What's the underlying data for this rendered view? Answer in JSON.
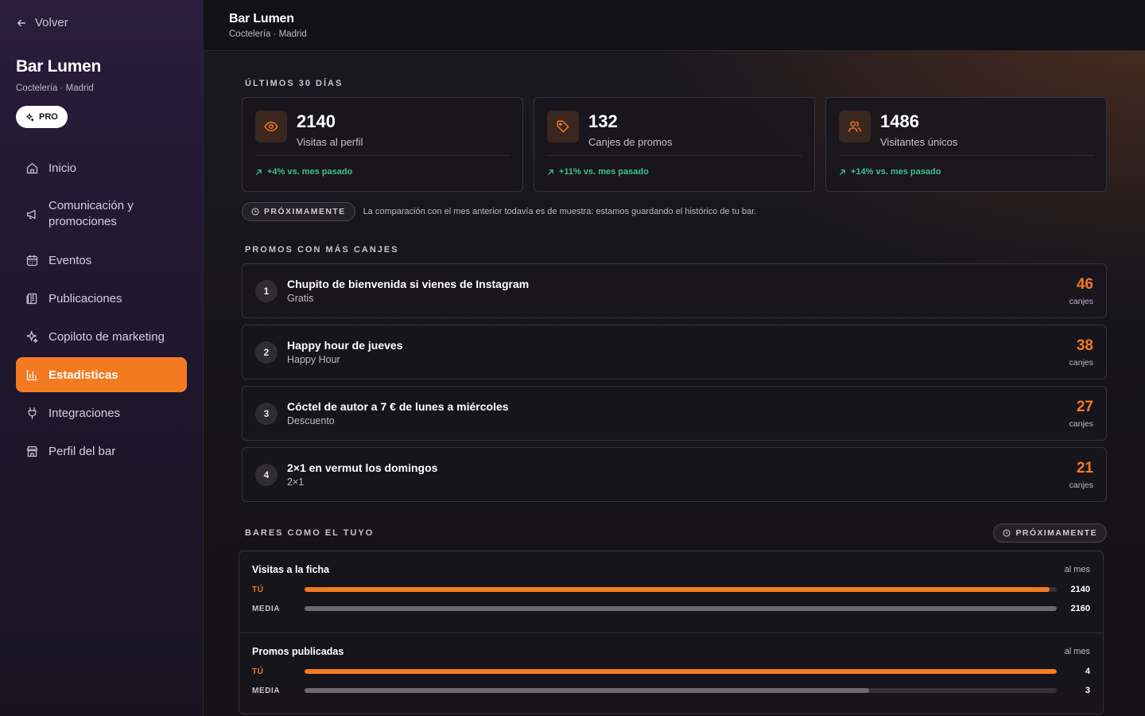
{
  "sidebar": {
    "back_label": "Volver",
    "bar_name": "Bar Lumen",
    "bar_subtitle": "Coctelería · Madrid",
    "plan_badge": "PRO",
    "nav": [
      {
        "label": "Inicio",
        "icon": "home-icon"
      },
      {
        "label": "Comunicación y promociones",
        "icon": "megaphone-icon"
      },
      {
        "label": "Eventos",
        "icon": "calendar-icon"
      },
      {
        "label": "Publicaciones",
        "icon": "newspaper-icon"
      },
      {
        "label": "Copiloto de marketing",
        "icon": "sparkles-icon"
      },
      {
        "label": "Estadísticas",
        "icon": "bar-chart-icon",
        "active": true
      },
      {
        "label": "Integraciones",
        "icon": "plug-icon"
      },
      {
        "label": "Perfil del bar",
        "icon": "store-icon"
      }
    ]
  },
  "header": {
    "title": "Bar Lumen",
    "subtitle": "Coctelería · Madrid"
  },
  "stats": {
    "section_label": "Últimos 30 días",
    "cards": [
      {
        "value": "2140",
        "label": "Visitas al perfil",
        "trend": "+4% vs. mes pasado",
        "icon": "eye-icon"
      },
      {
        "value": "132",
        "label": "Canjes de promos",
        "trend": "+11% vs. mes pasado",
        "icon": "tag-icon"
      },
      {
        "value": "1486",
        "label": "Visitantes únicos",
        "trend": "+14% vs. mes pasado",
        "icon": "users-icon"
      }
    ],
    "soon_badge": "PRÓXIMAMENTE",
    "soon_note": "La comparación con el mes anterior todavía es de muestra: estamos guardando el histórico de tu bar."
  },
  "promos": {
    "section_label": "Promos con más canjes",
    "unit": "canjes",
    "items": [
      {
        "rank": "1",
        "title": "Chupito de bienvenida si vienes de Instagram",
        "type": "Gratis",
        "count": "46"
      },
      {
        "rank": "2",
        "title": "Happy hour de jueves",
        "type": "Happy Hour",
        "count": "38"
      },
      {
        "rank": "3",
        "title": "Cóctel de autor a 7 € de lunes a miércoles",
        "type": "Descuento",
        "count": "27"
      },
      {
        "rank": "4",
        "title": "2×1 en vermut los domingos",
        "type": "2×1",
        "count": "21"
      }
    ]
  },
  "benchmark": {
    "section_label": "Bares como el tuyo",
    "soon_badge": "PRÓXIMAMENTE",
    "you_label": "TÚ",
    "avg_label": "MEDIA",
    "metrics": [
      {
        "title": "Visitas a la ficha",
        "unit": "al mes",
        "you": 2140,
        "avg": 2160,
        "you_label_value": "2140",
        "avg_label_value": "2160",
        "max": 2160
      },
      {
        "title": "Promos publicadas",
        "unit": "al mes",
        "you": 4,
        "avg": 3,
        "you_label_value": "4",
        "avg_label_value": "3",
        "max": 4
      }
    ]
  },
  "colors": {
    "accent": "#f47a22",
    "positive": "#3fc08a"
  }
}
